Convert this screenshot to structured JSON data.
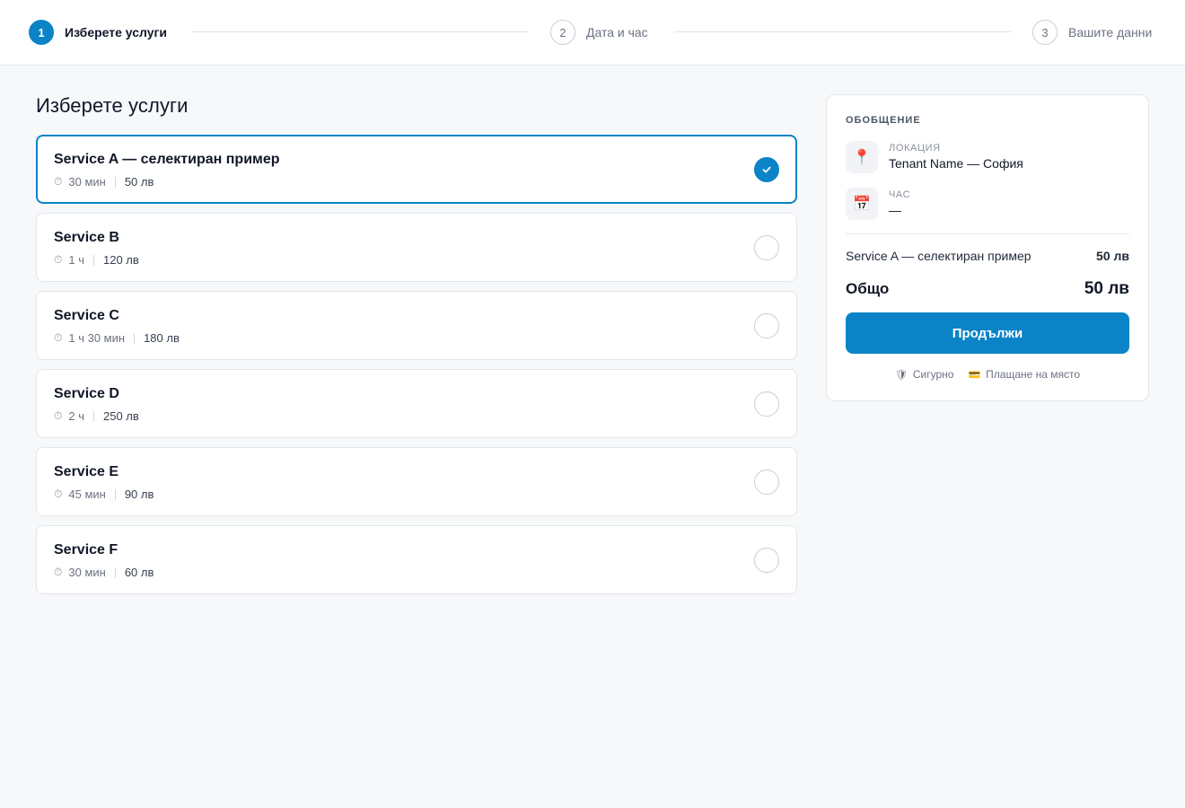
{
  "stepper": {
    "steps": [
      {
        "number": "1",
        "label": "Изберете услуги",
        "active": true
      },
      {
        "number": "2",
        "label": "Дата и час",
        "active": false
      },
      {
        "number": "3",
        "label": "Вашите данни",
        "active": false
      }
    ]
  },
  "main": {
    "title": "Изберете услуги",
    "services": [
      {
        "name": "Service A — селектиран пример",
        "duration": "30 мин",
        "price": "50 лв",
        "selected": true
      },
      {
        "name": "Service B",
        "duration": "1 ч",
        "price": "120 лв",
        "selected": false
      },
      {
        "name": "Service C",
        "duration": "1 ч 30 мин",
        "price": "180 лв",
        "selected": false
      },
      {
        "name": "Service D",
        "duration": "2 ч",
        "price": "250 лв",
        "selected": false
      },
      {
        "name": "Service E",
        "duration": "45 мин",
        "price": "90 лв",
        "selected": false
      },
      {
        "name": "Service F",
        "duration": "30 мин",
        "price": "60 лв",
        "selected": false
      }
    ]
  },
  "summary": {
    "title": "ОБОБЩЕНИЕ",
    "location_label": "Локация",
    "location_value": "Tenant Name — София",
    "time_label": "Час",
    "time_value": "—",
    "line_item_name": "Service A — селектиран пример",
    "line_item_price": "50 лв",
    "total_label": "Общо",
    "total_price": "50 лв",
    "continue_label": "Продължи",
    "secure_label": "Сигурно",
    "pay_label": "Плащане на място"
  },
  "icons": {
    "timer": "stopwatch-icon",
    "location": "pin-icon",
    "time": "calendar-icon",
    "secure": "shield-icon",
    "payment": "card-icon",
    "selected": "check-icon"
  },
  "colors": {
    "accent": "#0a84c6",
    "background": "#f6f8fa",
    "card": "#ffffff",
    "border": "#e3e6ea"
  }
}
